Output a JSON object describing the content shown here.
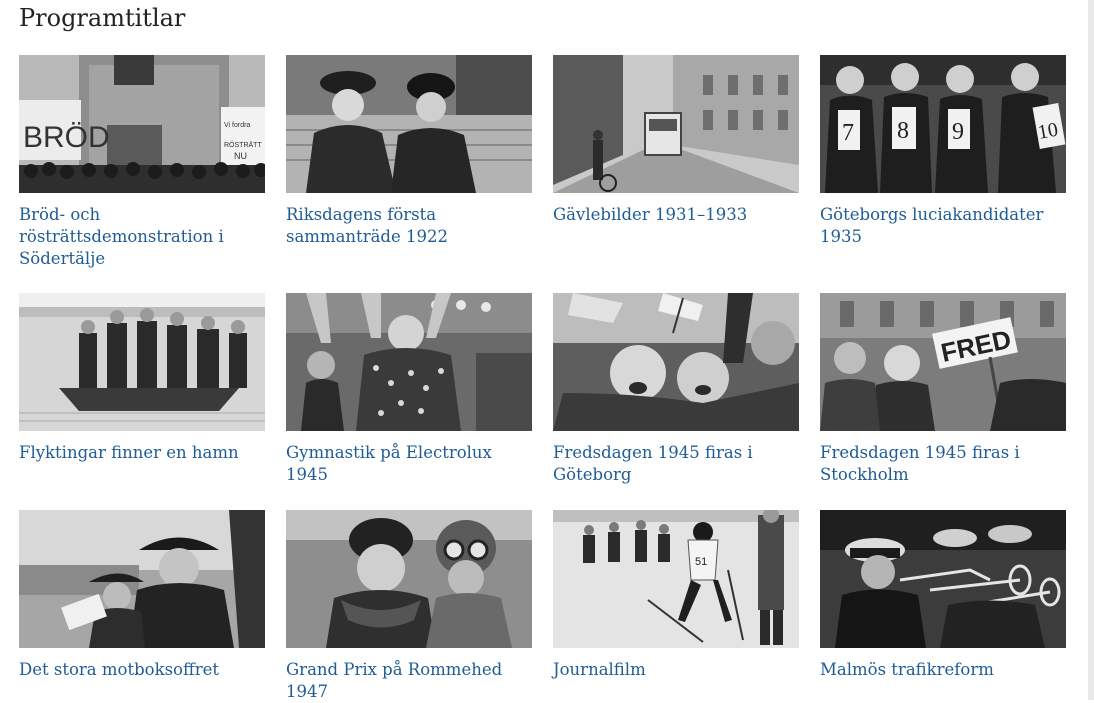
{
  "page": {
    "title": "Programtitlar"
  },
  "colors": {
    "link": "#1f5c96",
    "heading": "#222222",
    "background": "#ffffff"
  },
  "programs": [
    {
      "title": "Bröd- och rösträttsdemonstration i Södertälje",
      "sign_text": "BRÖD",
      "placard_text": "Vi fordra! ...rösträtt NU"
    },
    {
      "title": "Riksdagens första sammanträde 1922"
    },
    {
      "title": "Gävlebilder 1931–1933"
    },
    {
      "title": "Göteborgs luciakandidater 1935",
      "card_numbers": [
        "7",
        "8",
        "9",
        "10"
      ]
    },
    {
      "title": "Flyktingar finner en hamn"
    },
    {
      "title": "Gymnastik på Electrolux 1945"
    },
    {
      "title": "Fredsdagen 1945 firas i Göteborg"
    },
    {
      "title": "Fredsdagen 1945 firas i Stockholm",
      "sign_text": "FRED"
    },
    {
      "title": "Det stora motboksoffret"
    },
    {
      "title": "Grand Prix på Rommehed 1947"
    },
    {
      "title": "Journalfilm",
      "bib_number": "51"
    },
    {
      "title": "Malmös trafikreform"
    }
  ]
}
